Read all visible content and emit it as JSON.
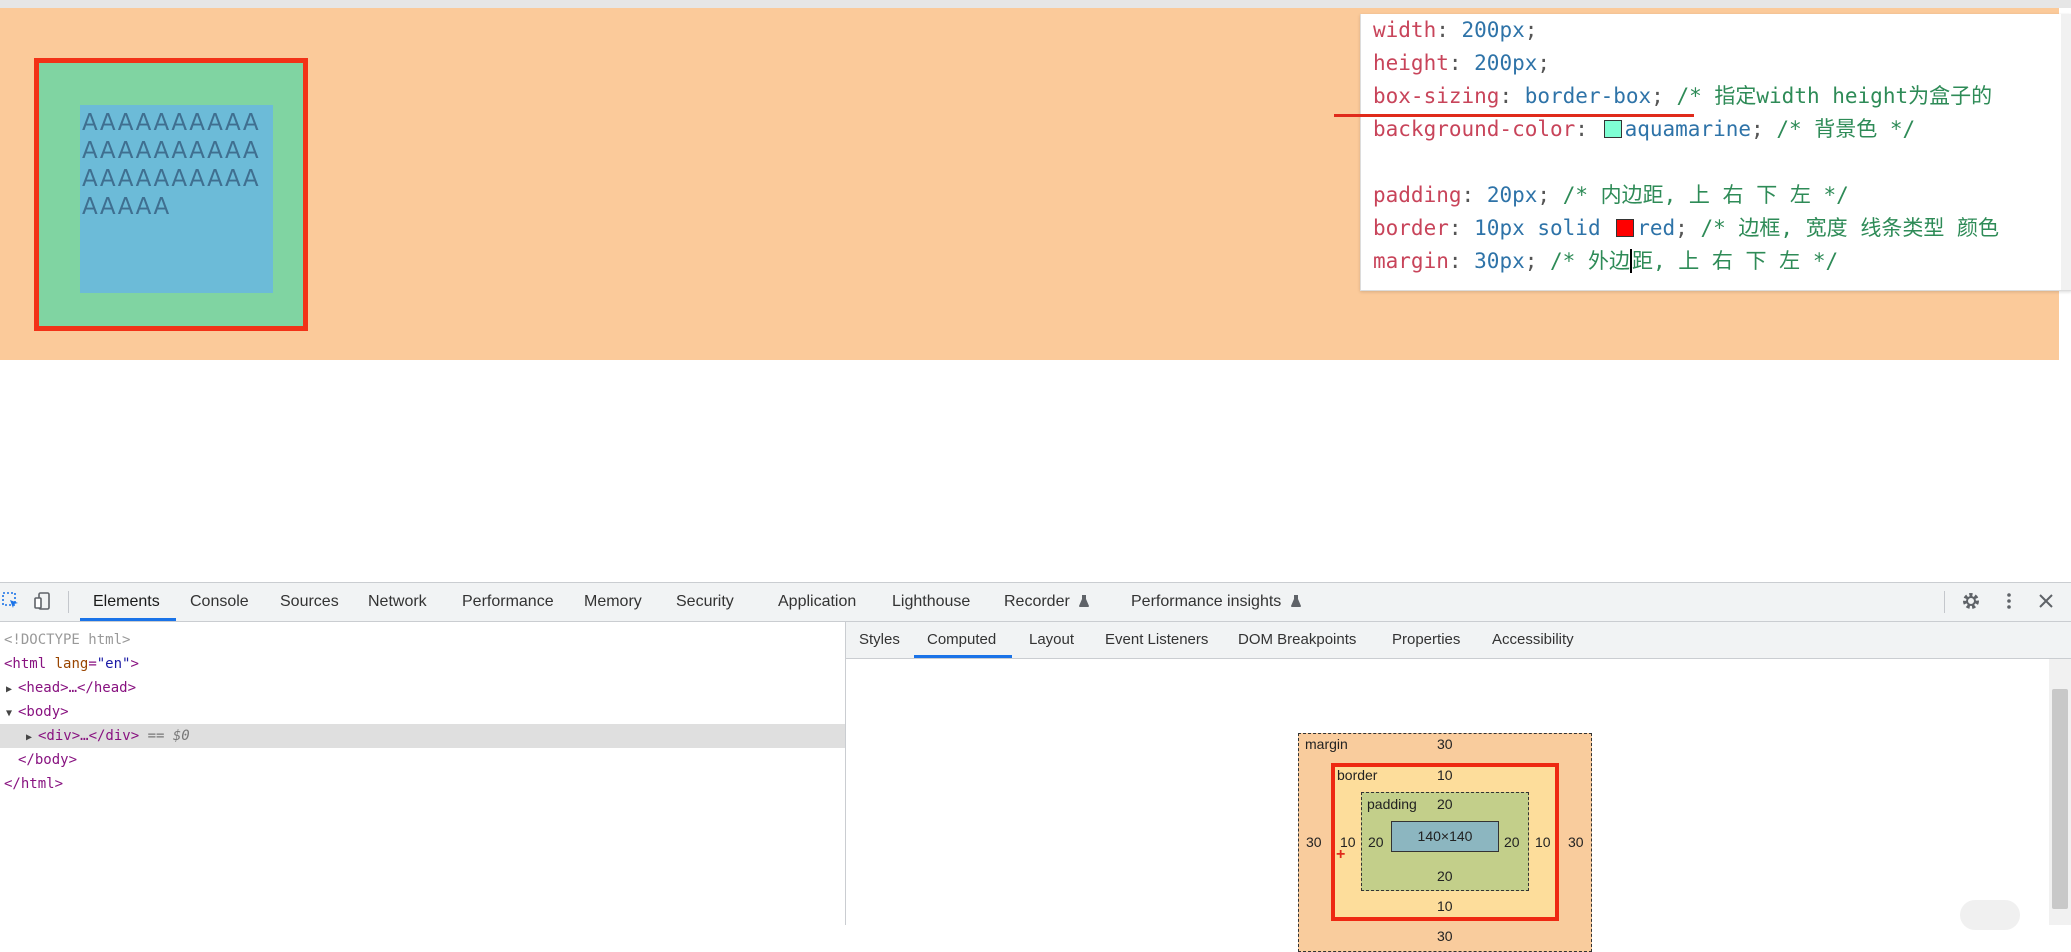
{
  "demo": {
    "text": "AAAAAAAAAAAAAAAAAAAAAAAAAAAAAAAAAAA"
  },
  "code": {
    "lines": [
      {
        "prop": "width",
        "value": "200px",
        "comment": ""
      },
      {
        "prop": "height",
        "value": "200px",
        "comment": ""
      },
      {
        "prop": "box-sizing",
        "value": "border-box",
        "comment": "/* 指定width height为盒子的"
      },
      {
        "prop": "background-color",
        "value": "aquamarine",
        "comment": "/* 背景色 */",
        "swatch": "#7fffd4"
      },
      {
        "prop": "padding",
        "value": "20px",
        "comment": "/* 内边距, 上 右 下 左 */"
      },
      {
        "prop": "border",
        "value_pre": "10px solid ",
        "value": "red",
        "comment": "/* 边框, 宽度 线条类型 颜色",
        "swatch": "#ff0000"
      },
      {
        "prop": "margin",
        "value": "30px",
        "comment_pre": "/* 外边",
        "comment": "距, 上 右 下 左 */"
      }
    ]
  },
  "devtools": {
    "tabs": [
      "Elements",
      "Console",
      "Sources",
      "Network",
      "Performance",
      "Memory",
      "Security",
      "Application",
      "Lighthouse",
      "Recorder",
      "Performance insights"
    ],
    "active_tab": "Elements",
    "icons": {
      "inspect": "inspect-icon",
      "device": "device-toggle-icon",
      "settings": "gear-icon",
      "more": "more-vertical-icon",
      "close": "close-icon",
      "flask": "flask-icon"
    },
    "dom": {
      "doctype": "<!DOCTYPE html>",
      "html_open_tag": "<html",
      "html_attr_name": "lang",
      "html_attr_value": "\"en\"",
      "html_open_end": ">",
      "head": "<head>…</head>",
      "body_open": "<body>",
      "div": "<div>…</div>",
      "div_marker": "== $0",
      "body_close": "</body>",
      "html_close": "</html>"
    },
    "side_tabs": [
      "Styles",
      "Computed",
      "Layout",
      "Event Listeners",
      "DOM Breakpoints",
      "Properties",
      "Accessibility"
    ],
    "active_side_tab": "Computed",
    "box_model": {
      "margin_label": "margin",
      "border_label": "border",
      "padding_label": "padding",
      "margin": {
        "top": "30",
        "right": "30",
        "bottom": "30",
        "left": "30"
      },
      "border": {
        "top": "10",
        "right": "10",
        "bottom": "10",
        "left": "10"
      },
      "padding": {
        "top": "20",
        "right": "20",
        "bottom": "20",
        "left": "20"
      },
      "content": "140×140",
      "move_cursor": "+"
    }
  },
  "colors": {
    "page_bg": "#fbca9a",
    "border_red": "#f23217",
    "padding_green": "#80d4a2",
    "content_blue": "#6cbbd8",
    "active_blue": "#1a73e8"
  }
}
